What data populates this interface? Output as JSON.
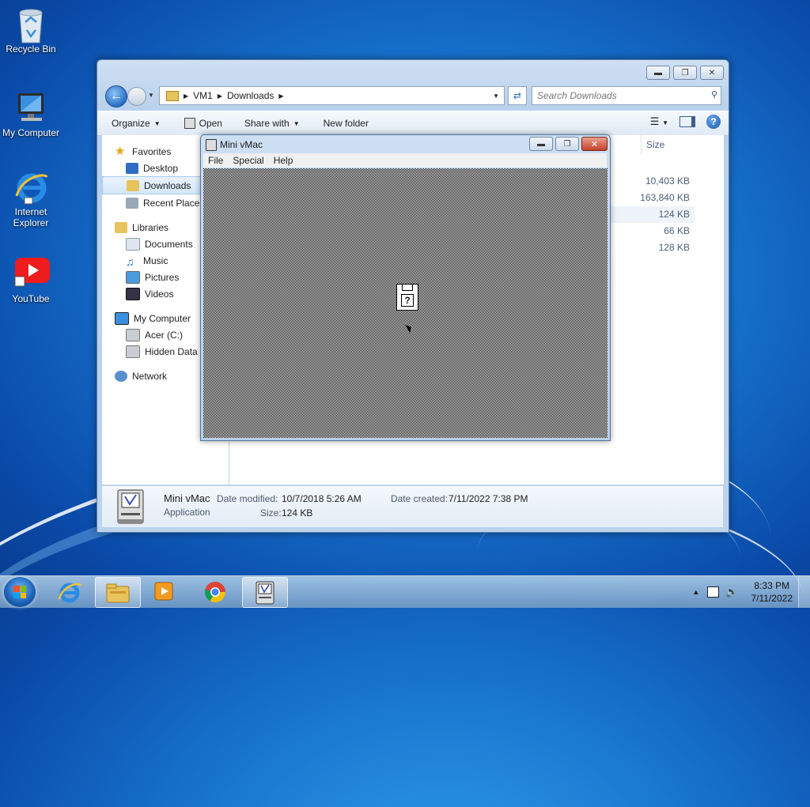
{
  "desktop": {
    "icons": [
      {
        "label": "Recycle Bin",
        "icon": "recycle-bin-icon"
      },
      {
        "label": "My Computer",
        "icon": "computer-icon"
      },
      {
        "label": "Internet Explorer",
        "icon": "internet-explorer-icon"
      },
      {
        "label": "YouTube",
        "icon": "youtube-icon"
      }
    ]
  },
  "explorer": {
    "breadcrumb": [
      "VM1",
      "Downloads"
    ],
    "search_placeholder": "Search Downloads",
    "toolbar": {
      "organize": "Organize",
      "open": "Open",
      "share_with": "Share with",
      "new_folder": "New folder"
    },
    "nav": {
      "favorites": "Favorites",
      "favorites_items": [
        "Desktop",
        "Downloads",
        "Recent Places"
      ],
      "libraries": "Libraries",
      "libraries_items": [
        "Documents",
        "Music",
        "Pictures",
        "Videos"
      ],
      "computer": "My Computer",
      "computer_items": [
        "Acer (C:)",
        "Hidden Data P"
      ],
      "network": "Network",
      "selected": "Downloads"
    },
    "column_size": "Size",
    "sizes": [
      "10,403 KB",
      "163,840 KB",
      "124 KB",
      "66 KB",
      "128 KB"
    ],
    "details": {
      "name": "Mini vMac",
      "type": "Application",
      "date_modified_label": "Date modified:",
      "date_modified": "10/7/2018 5:26 AM",
      "date_created_label": "Date created:",
      "date_created": "7/11/2022 7:38 PM",
      "size_label": "Size:",
      "size": "124 KB"
    }
  },
  "minivmac": {
    "title": "Mini vMac",
    "menu": [
      "File",
      "Special",
      "Help"
    ],
    "screen_icon": "question-mark-disk-icon"
  },
  "taskbar": {
    "apps": [
      "internet-explorer-icon",
      "file-explorer-icon",
      "media-player-icon",
      "chrome-icon",
      "mini-vmac-icon"
    ],
    "time": "8:33 PM",
    "date": "7/11/2022"
  },
  "colors": {
    "accent": "#2a6fc5",
    "selection": "#d5e7fa",
    "close_red": "#c2432a"
  }
}
